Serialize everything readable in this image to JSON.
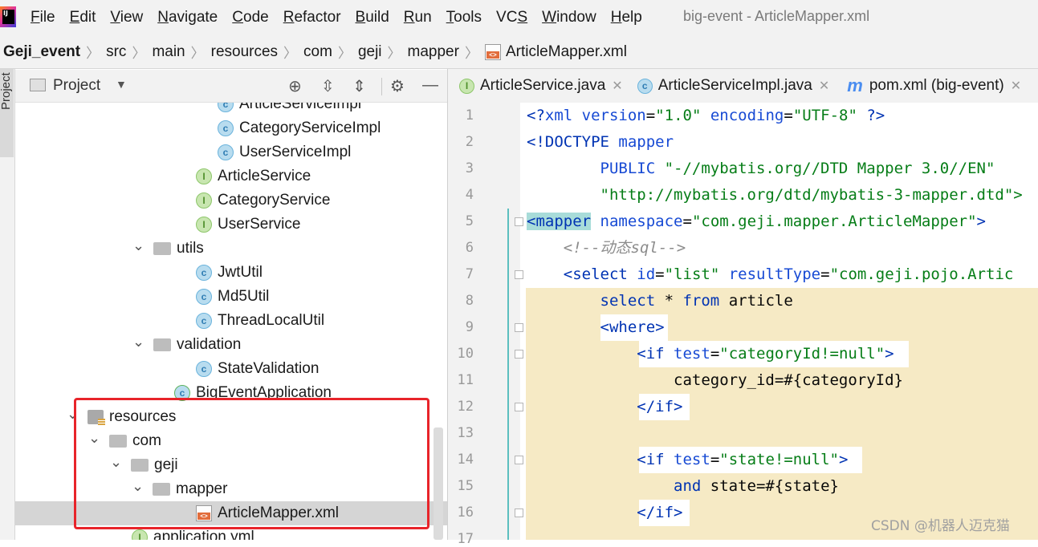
{
  "menubar": {
    "logo_text": "IJ",
    "items": [
      {
        "underline": "F",
        "rest": "ile"
      },
      {
        "underline": "E",
        "rest": "dit"
      },
      {
        "underline": "V",
        "rest": "iew"
      },
      {
        "underline": "N",
        "rest": "avigate"
      },
      {
        "underline": "C",
        "rest": "ode"
      },
      {
        "underline": "R",
        "rest": "efactor"
      },
      {
        "underline": "B",
        "rest": "uild"
      },
      {
        "underline": "R",
        "rest": "un"
      },
      {
        "underline": "T",
        "rest": "ools"
      },
      {
        "underline": "",
        "rest": "VC",
        "suffix_u": "S"
      },
      {
        "underline": "W",
        "rest": "indow"
      },
      {
        "underline": "H",
        "rest": "elp"
      }
    ],
    "window_title": "big-event - ArticleMapper.xml"
  },
  "breadcrumb": [
    "Geji_event",
    "src",
    "main",
    "resources",
    "com",
    "geji",
    "mapper",
    "ArticleMapper.xml"
  ],
  "project_panel": {
    "stripe_label": "Project",
    "title": "Project",
    "tree": [
      {
        "label": "ArticleServiceImpl",
        "icon": "class",
        "indent": 252,
        "chevron": ""
      },
      {
        "label": "CategoryServiceImpl",
        "icon": "class",
        "indent": 252,
        "chevron": ""
      },
      {
        "label": "UserServiceImpl",
        "icon": "class",
        "indent": 252,
        "chevron": ""
      },
      {
        "label": "ArticleService",
        "icon": "iface",
        "indent": 225,
        "chevron": ""
      },
      {
        "label": "CategoryService",
        "icon": "iface",
        "indent": 225,
        "chevron": ""
      },
      {
        "label": "UserService",
        "icon": "iface",
        "indent": 225,
        "chevron": ""
      },
      {
        "label": "utils",
        "icon": "pkg",
        "indent": 172,
        "chevron": "v"
      },
      {
        "label": "JwtUtil",
        "icon": "class",
        "indent": 225,
        "chevron": ""
      },
      {
        "label": "Md5Util",
        "icon": "class",
        "indent": 225,
        "chevron": ""
      },
      {
        "label": "ThreadLocalUtil",
        "icon": "class",
        "indent": 225,
        "chevron": ""
      },
      {
        "label": "validation",
        "icon": "pkg",
        "indent": 172,
        "chevron": "v"
      },
      {
        "label": "StateValidation",
        "icon": "class",
        "indent": 225,
        "chevron": ""
      },
      {
        "label": "BigEventApplication",
        "icon": "app",
        "indent": 198,
        "chevron": ""
      },
      {
        "label": "resources",
        "icon": "res",
        "indent": 90,
        "chevron": "v"
      },
      {
        "label": "com",
        "icon": "pkg",
        "indent": 117,
        "chevron": "v"
      },
      {
        "label": "geji",
        "icon": "pkg",
        "indent": 144,
        "chevron": "v"
      },
      {
        "label": "mapper",
        "icon": "pkg",
        "indent": 171,
        "chevron": "v"
      },
      {
        "label": "ArticleMapper.xml",
        "icon": "xml",
        "indent": 225,
        "chevron": "",
        "selected": true
      },
      {
        "label": "application.yml",
        "icon": "iface",
        "indent": 145,
        "chevron": ""
      }
    ]
  },
  "editor": {
    "tabs": [
      {
        "label": "ArticleService.java",
        "icon": "iface"
      },
      {
        "label": "ArticleServiceImpl.java",
        "icon": "class"
      },
      {
        "label": "pom.xml (big-event)",
        "icon": "maven"
      }
    ],
    "line_numbers": [
      "1",
      "2",
      "3",
      "4",
      "5",
      "6",
      "7",
      "8",
      "9",
      "10",
      "11",
      "12",
      "13",
      "14",
      "15",
      "16",
      "17"
    ],
    "code": [
      {
        "parts": [
          [
            "c-tag",
            "<?"
          ],
          [
            "c-attr",
            "xml version"
          ],
          [
            "c-txt",
            "="
          ],
          [
            "c-str",
            "\"1.0\""
          ],
          [
            "c-txt",
            " "
          ],
          [
            "c-attr",
            "encoding"
          ],
          [
            "c-txt",
            "="
          ],
          [
            "c-str",
            "\"UTF-8\""
          ],
          [
            "c-txt",
            " "
          ],
          [
            "c-tag",
            "?>"
          ]
        ]
      },
      {
        "parts": [
          [
            "c-tag",
            "<!DOCTYPE "
          ],
          [
            "c-attr",
            "mapper"
          ]
        ]
      },
      {
        "parts": [
          [
            "c-txt",
            "        "
          ],
          [
            "c-attr",
            "PUBLIC "
          ],
          [
            "c-str",
            "\"-//mybatis.org//DTD Mapper 3.0//EN\""
          ]
        ]
      },
      {
        "parts": [
          [
            "c-txt",
            "        "
          ],
          [
            "c-str",
            "\"http://mybatis.org/dtd/mybatis-3-mapper.dtd\">"
          ]
        ]
      },
      {
        "parts": [
          [
            "c-tag mapper-tag-hl",
            "<mapper"
          ],
          [
            "c-txt",
            " "
          ],
          [
            "c-attr",
            "namespace"
          ],
          [
            "c-txt",
            "="
          ],
          [
            "c-str",
            "\"com.geji.mapper.ArticleMapper\""
          ],
          [
            "c-tag",
            ">"
          ]
        ]
      },
      {
        "parts": [
          [
            "c-txt",
            "    "
          ],
          [
            "c-com",
            "<!--动态sql-->"
          ]
        ]
      },
      {
        "parts": [
          [
            "c-txt",
            "    "
          ],
          [
            "c-tag",
            "<select "
          ],
          [
            "c-attr",
            "id"
          ],
          [
            "c-txt",
            "="
          ],
          [
            "c-str",
            "\"list\""
          ],
          [
            "c-txt",
            " "
          ],
          [
            "c-attr",
            "resultType"
          ],
          [
            "c-txt",
            "="
          ],
          [
            "c-str",
            "\"com.geji.pojo.Artic"
          ]
        ]
      },
      {
        "parts": [
          [
            "c-txt",
            "        "
          ],
          [
            "c-kw",
            "select"
          ],
          [
            "c-txt",
            " * "
          ],
          [
            "c-kw",
            "from"
          ],
          [
            "c-txt",
            " article"
          ]
        ]
      },
      {
        "parts": [
          [
            "c-txt",
            "        "
          ],
          [
            "c-tag",
            "<where>"
          ]
        ]
      },
      {
        "parts": [
          [
            "c-txt",
            "            "
          ],
          [
            "c-tag",
            "<if "
          ],
          [
            "c-attr",
            "test"
          ],
          [
            "c-txt",
            "="
          ],
          [
            "c-str",
            "\"categoryId!=null\""
          ],
          [
            "c-tag",
            ">"
          ]
        ]
      },
      {
        "parts": [
          [
            "c-txt",
            "                category_id=#{categoryId}"
          ]
        ]
      },
      {
        "parts": [
          [
            "c-txt",
            "            "
          ],
          [
            "c-tag",
            "</if>"
          ]
        ]
      },
      {
        "parts": [
          [
            "c-txt",
            ""
          ]
        ]
      },
      {
        "parts": [
          [
            "c-txt",
            "            "
          ],
          [
            "c-tag",
            "<if "
          ],
          [
            "c-attr",
            "test"
          ],
          [
            "c-txt",
            "="
          ],
          [
            "c-str",
            "\"state!=null\""
          ],
          [
            "c-tag",
            ">"
          ]
        ]
      },
      {
        "parts": [
          [
            "c-txt",
            "                "
          ],
          [
            "c-kw",
            "and"
          ],
          [
            "c-txt",
            " state=#{state}"
          ]
        ]
      },
      {
        "parts": [
          [
            "c-txt",
            "            "
          ],
          [
            "c-tag",
            "</if>"
          ]
        ]
      },
      {
        "parts": [
          [
            "c-txt",
            ""
          ]
        ]
      }
    ]
  },
  "watermark": "CSDN @机器人迈克猫",
  "colors": {
    "highlight_box": "#e8242a",
    "caret_row_bg": "#f6eac5",
    "selection_bg": "#d5d5d5"
  }
}
